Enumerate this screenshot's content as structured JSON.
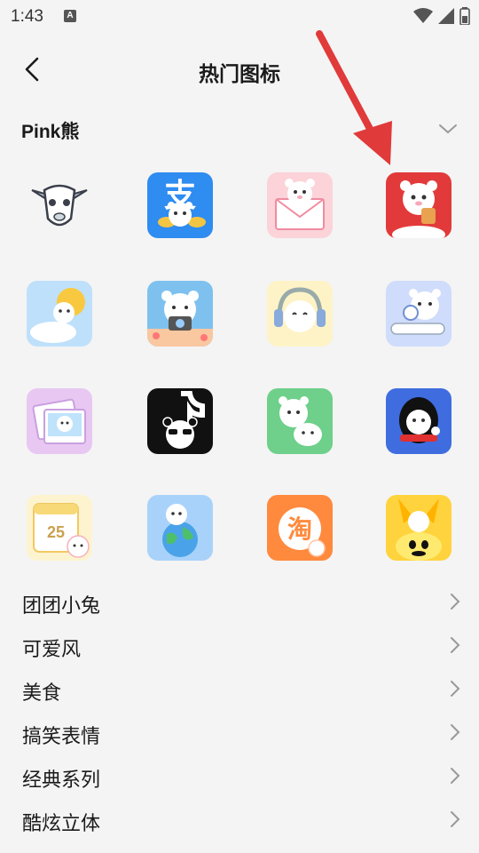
{
  "status_bar": {
    "time": "1:43",
    "notification_icon": "A"
  },
  "header": {
    "title": "热门图标",
    "back_icon": "chevron-left-icon"
  },
  "section": {
    "label": "Pink熊",
    "toggle_icon": "chevron-down-icon"
  },
  "icons": [
    {
      "name": "goat"
    },
    {
      "name": "alipay-bear"
    },
    {
      "name": "mail-bear"
    },
    {
      "name": "red-bear"
    },
    {
      "name": "weather-bear"
    },
    {
      "name": "camera-bear"
    },
    {
      "name": "music-bear"
    },
    {
      "name": "search-bear"
    },
    {
      "name": "gallery-bear"
    },
    {
      "name": "tiktok-bear"
    },
    {
      "name": "wechat-bear"
    },
    {
      "name": "qq-bear"
    },
    {
      "name": "calendar-bear"
    },
    {
      "name": "browser-bear"
    },
    {
      "name": "taobao-bear"
    },
    {
      "name": "fish-bear"
    }
  ],
  "calendar_number": "25",
  "taobao_char": "淘",
  "list": [
    {
      "label": "团团小兔"
    },
    {
      "label": "可爱风"
    },
    {
      "label": "美食"
    },
    {
      "label": "搞笑表情"
    },
    {
      "label": "经典系列"
    },
    {
      "label": "酷炫立体"
    }
  ]
}
